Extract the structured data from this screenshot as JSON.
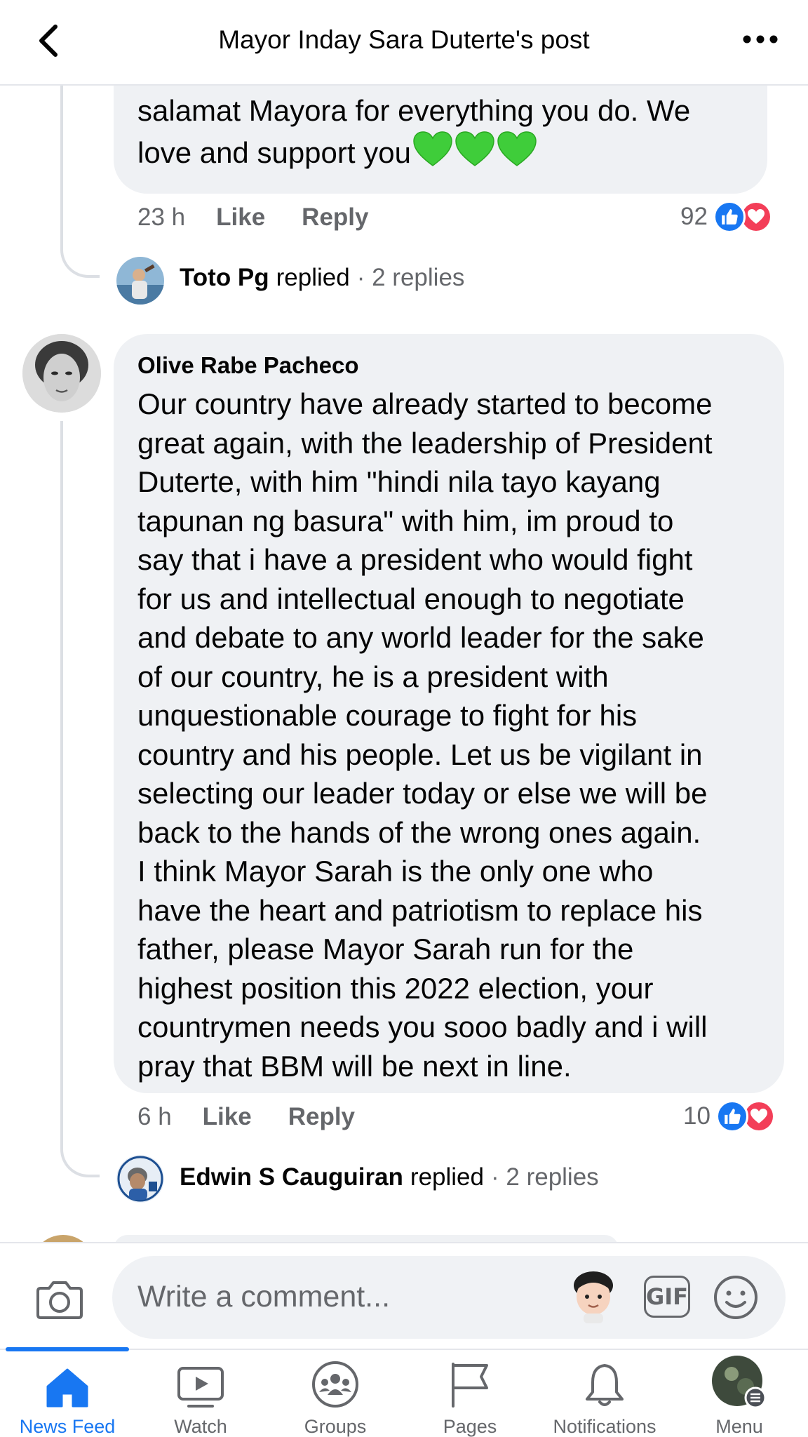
{
  "header": {
    "title": "Mayor Inday Sara Duterte's post"
  },
  "comment1": {
    "text_line1": "salamat Mayora for everything you do. We",
    "text_line2": "love and support you",
    "time": "23 h",
    "like_label": "Like",
    "reply_label": "Reply",
    "reaction_count": "92",
    "replied_by": "Toto Pg",
    "replied_word": "replied",
    "replies_count": "· 2 replies"
  },
  "comment2": {
    "author": "Olive Rabe Pacheco",
    "lines": [
      "Our country have already started to become",
      "great again, with the leadership of President",
      "Duterte, with him \"hindi nila tayo kayang",
      "tapunan ng basura\" with him, im proud to",
      "say that i have a president who would fight",
      "for us and intellectual enough to negotiate",
      "and debate to any world leader for the sake",
      "of our country, he is a president with",
      "unquestionable courage to fight for his",
      "country and his people. Let us be vigilant in",
      "selecting our leader today or else we will be",
      "back to the hands of the wrong ones again.",
      "I think Mayor Sarah is the only one who",
      "have the heart and patriotism to replace his",
      "father, please Mayor Sarah run for the",
      "highest position this 2022 election, your",
      "countrymen needs you sooo badly and i will",
      "pray that BBM will be next in line."
    ],
    "time": "6 h",
    "like_label": "Like",
    "reply_label": "Reply",
    "reaction_count": "10",
    "replied_by": "Edwin S Cauguiran",
    "replied_word": "replied",
    "replies_count": "· 2 replies"
  },
  "composer": {
    "placeholder": "Write a comment...",
    "gif_label": "GIF"
  },
  "nav": {
    "items": [
      {
        "label": "News Feed",
        "icon": "home-icon"
      },
      {
        "label": "Watch",
        "icon": "watch-icon"
      },
      {
        "label": "Groups",
        "icon": "groups-icon"
      },
      {
        "label": "Pages",
        "icon": "flag-icon"
      },
      {
        "label": "Notifications",
        "icon": "bell-icon"
      },
      {
        "label": "Menu",
        "icon": "menu-icon"
      }
    ]
  },
  "colors": {
    "accent": "#1877f2",
    "love": "#f33e58",
    "bubble": "#eff1f4",
    "secondary_text": "#65676b",
    "heart_emoji": "#3fcd3a"
  }
}
